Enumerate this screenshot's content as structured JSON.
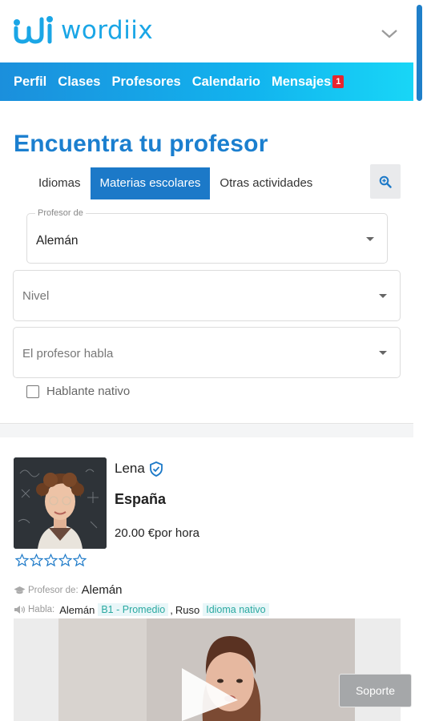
{
  "header": {
    "brand": "wordiix",
    "brand_color": "#1aa6e6"
  },
  "nav": {
    "items": [
      {
        "label": "Perfil"
      },
      {
        "label": "Clases"
      },
      {
        "label": "Profesores"
      },
      {
        "label": "Calendario"
      },
      {
        "label": "Mensajes",
        "badge": "1"
      }
    ]
  },
  "page": {
    "title": "Encuentra tu profesor"
  },
  "tabs": [
    {
      "label": "Idiomas",
      "active": false
    },
    {
      "label": "Materias escolares",
      "active": true
    },
    {
      "label": "Otras actividades",
      "active": false
    }
  ],
  "filters": {
    "teacher_of": {
      "label": "Profesor de",
      "value": "Alemán"
    },
    "level": {
      "placeholder": "Nivel"
    },
    "speaks": {
      "placeholder": "El profesor habla"
    },
    "native": {
      "label": "Hablante nativo",
      "checked": false
    }
  },
  "teacher": {
    "name": "Lena",
    "country": "España",
    "price": "20.00 €por hora",
    "rating": 0,
    "teaches_label": "Profesor de:",
    "teaches_value": "Alemán",
    "speaks_label": "Habla:",
    "languages": [
      {
        "name": "Alemán",
        "level": "B1 - Promedio"
      },
      {
        "name": "Ruso",
        "level": "Idioma nativo"
      }
    ],
    "separator": ","
  },
  "support": {
    "label": "Soporte"
  },
  "colors": {
    "accent": "#1c79c8",
    "title": "#1b7fcf",
    "tag_text": "#2aa9a1"
  }
}
